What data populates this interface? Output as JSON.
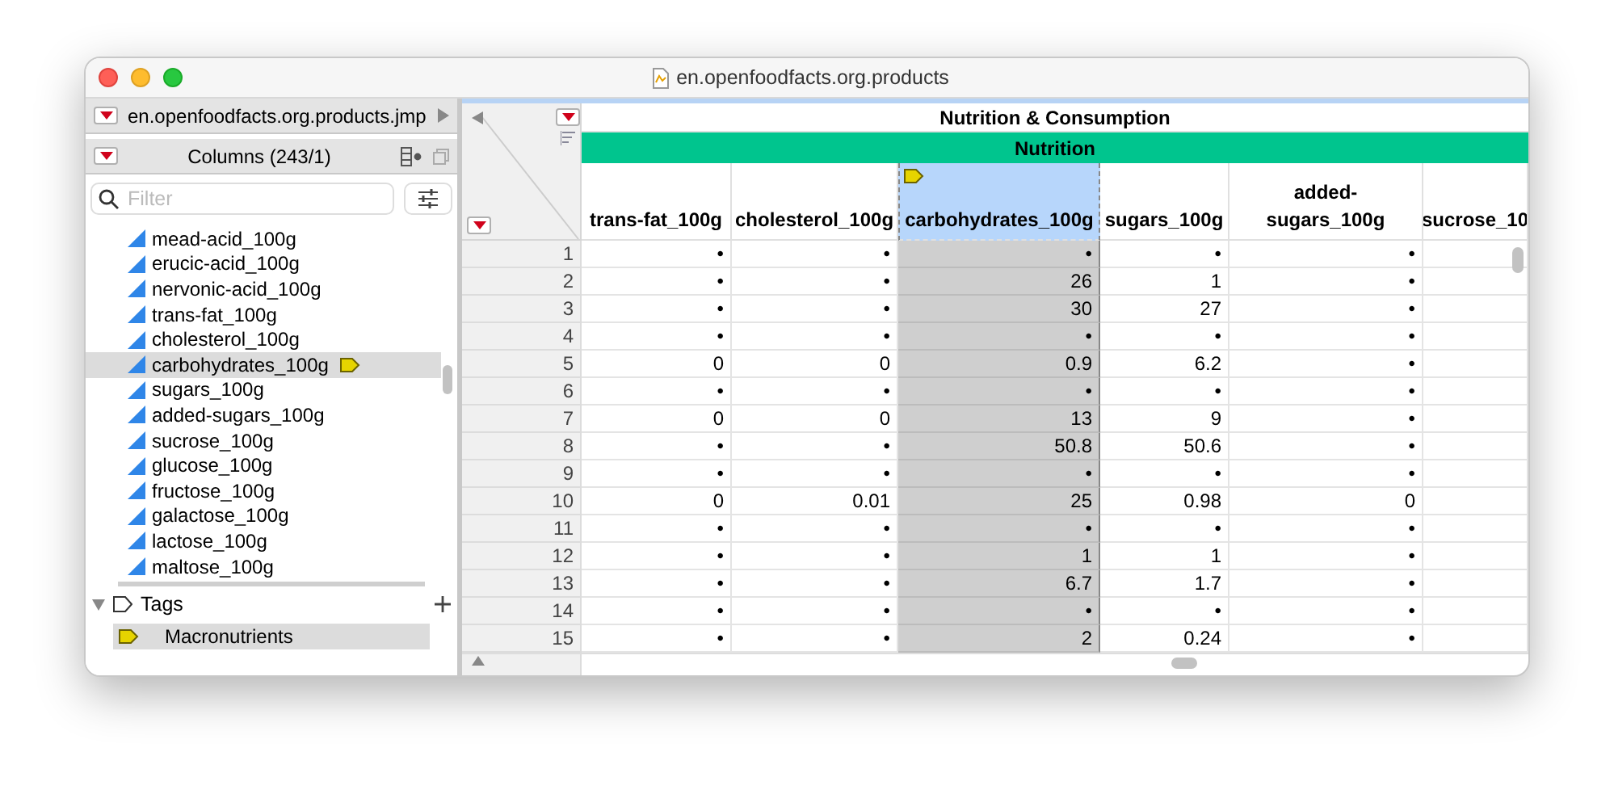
{
  "window": {
    "title": "en.openfoodfacts.org.products"
  },
  "sidebar": {
    "table_name": "en.openfoodfacts.org.products.jmp",
    "columns_title": "Columns (243/1)",
    "filter": {
      "placeholder": "Filter"
    },
    "columns": [
      {
        "name": "mead-acid_100g",
        "selected": false,
        "tagged": false
      },
      {
        "name": "erucic-acid_100g",
        "selected": false,
        "tagged": false
      },
      {
        "name": "nervonic-acid_100g",
        "selected": false,
        "tagged": false
      },
      {
        "name": "trans-fat_100g",
        "selected": false,
        "tagged": false
      },
      {
        "name": "cholesterol_100g",
        "selected": false,
        "tagged": false
      },
      {
        "name": "carbohydrates_100g",
        "selected": true,
        "tagged": true
      },
      {
        "name": "sugars_100g",
        "selected": false,
        "tagged": false
      },
      {
        "name": "added-sugars_100g",
        "selected": false,
        "tagged": false
      },
      {
        "name": "sucrose_100g",
        "selected": false,
        "tagged": false
      },
      {
        "name": "glucose_100g",
        "selected": false,
        "tagged": false
      },
      {
        "name": "fructose_100g",
        "selected": false,
        "tagged": false
      },
      {
        "name": "galactose_100g",
        "selected": false,
        "tagged": false
      },
      {
        "name": "lactose_100g",
        "selected": false,
        "tagged": false
      },
      {
        "name": "maltose_100g",
        "selected": false,
        "tagged": false
      }
    ],
    "tags_title": "Tags",
    "tags": [
      {
        "name": "Macronutrients",
        "selected": true
      }
    ]
  },
  "table": {
    "group_title": "Nutrition & Consumption",
    "subgroup_title": "Nutrition",
    "columns": [
      {
        "name": "trans-fat_100g",
        "selected": false,
        "tagged": false
      },
      {
        "name": "cholesterol_100g",
        "selected": false,
        "tagged": false
      },
      {
        "name": "carbohydrates_100g",
        "selected": true,
        "tagged": true
      },
      {
        "name": "sugars_100g",
        "selected": false,
        "tagged": false
      },
      {
        "name": "added-sugars_100g",
        "selected": false,
        "tagged": false
      },
      {
        "name": "sucrose_10",
        "selected": false,
        "tagged": false
      }
    ],
    "rows": [
      {
        "number": "1",
        "cells": [
          "•",
          "•",
          "•",
          "•",
          "•"
        ]
      },
      {
        "number": "2",
        "cells": [
          "•",
          "•",
          "26",
          "1",
          "•"
        ]
      },
      {
        "number": "3",
        "cells": [
          "•",
          "•",
          "30",
          "27",
          "•"
        ]
      },
      {
        "number": "4",
        "cells": [
          "•",
          "•",
          "•",
          "•",
          "•"
        ]
      },
      {
        "number": "5",
        "cells": [
          "0",
          "0",
          "0.9",
          "6.2",
          "•"
        ]
      },
      {
        "number": "6",
        "cells": [
          "•",
          "•",
          "•",
          "•",
          "•"
        ]
      },
      {
        "number": "7",
        "cells": [
          "0",
          "0",
          "13",
          "9",
          "•"
        ]
      },
      {
        "number": "8",
        "cells": [
          "•",
          "•",
          "50.8",
          "50.6",
          "•"
        ]
      },
      {
        "number": "9",
        "cells": [
          "•",
          "•",
          "•",
          "•",
          "•"
        ]
      },
      {
        "number": "10",
        "cells": [
          "0",
          "0.01",
          "25",
          "0.98",
          "0"
        ]
      },
      {
        "number": "11",
        "cells": [
          "•",
          "•",
          "•",
          "•",
          "•"
        ]
      },
      {
        "number": "12",
        "cells": [
          "•",
          "•",
          "1",
          "1",
          "•"
        ]
      },
      {
        "number": "13",
        "cells": [
          "•",
          "•",
          "6.7",
          "1.7",
          "•"
        ]
      },
      {
        "number": "14",
        "cells": [
          "•",
          "•",
          "•",
          "•",
          "•"
        ]
      },
      {
        "number": "15",
        "cells": [
          "•",
          "•",
          "2",
          "0.24",
          "•"
        ]
      }
    ]
  }
}
